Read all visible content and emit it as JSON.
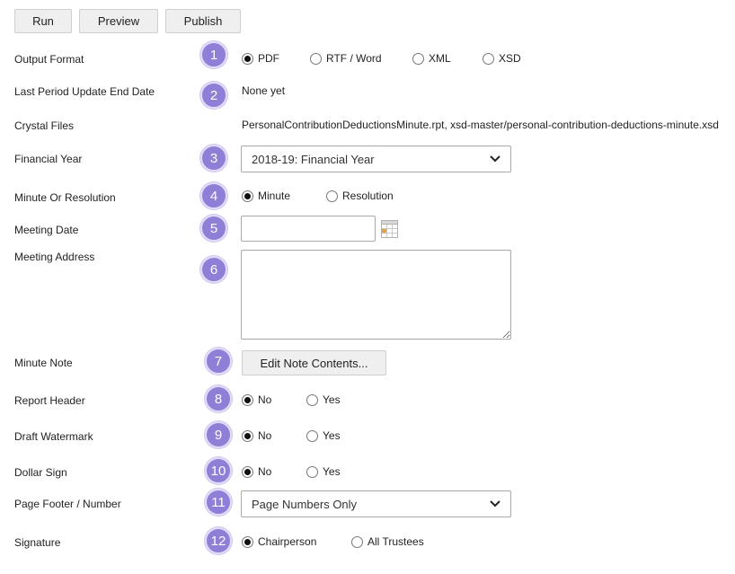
{
  "toolbar": {
    "run_label": "Run",
    "preview_label": "Preview",
    "publish_label": "Publish"
  },
  "rows": {
    "output_format": {
      "label": "Output Format",
      "badge": "1",
      "options": [
        "PDF",
        "RTF / Word",
        "XML",
        "XSD"
      ],
      "selected": "PDF"
    },
    "last_period": {
      "label": "Last Period Update End Date",
      "badge": "2",
      "value": "None yet"
    },
    "crystal_files": {
      "label": "Crystal Files",
      "value": "PersonalContributionDeductionsMinute.rpt, xsd-master/personal-contribution-deductions-minute.xsd"
    },
    "financial_year": {
      "label": "Financial Year",
      "badge": "3",
      "selected": "2018-19: Financial Year"
    },
    "minute_or_resolution": {
      "label": "Minute Or Resolution",
      "badge": "4",
      "options": [
        "Minute",
        "Resolution"
      ],
      "selected": "Minute"
    },
    "meeting_date": {
      "label": "Meeting Date",
      "badge": "5",
      "value": "",
      "calendar_icon": "calendar-icon"
    },
    "meeting_address": {
      "label": "Meeting Address",
      "badge": "6",
      "value": ""
    },
    "minute_note": {
      "label": "Minute Note",
      "badge": "7",
      "button_label": "Edit Note Contents..."
    },
    "report_header": {
      "label": "Report Header",
      "badge": "8",
      "options": [
        "No",
        "Yes"
      ],
      "selected": "No"
    },
    "draft_watermark": {
      "label": "Draft Watermark",
      "badge": "9",
      "options": [
        "No",
        "Yes"
      ],
      "selected": "No"
    },
    "dollar_sign": {
      "label": "Dollar Sign",
      "badge": "10",
      "options": [
        "No",
        "Yes"
      ],
      "selected": "No"
    },
    "page_footer": {
      "label": "Page Footer / Number",
      "badge": "11",
      "selected": "Page Numbers Only"
    },
    "signature": {
      "label": "Signature",
      "badge": "12",
      "options": [
        "Chairperson",
        "All Trustees"
      ],
      "selected": "Chairperson"
    }
  },
  "colors": {
    "badge_fill": "#8f7fd6",
    "badge_ring": "#e4ddfa",
    "button_bg": "#efefef"
  }
}
